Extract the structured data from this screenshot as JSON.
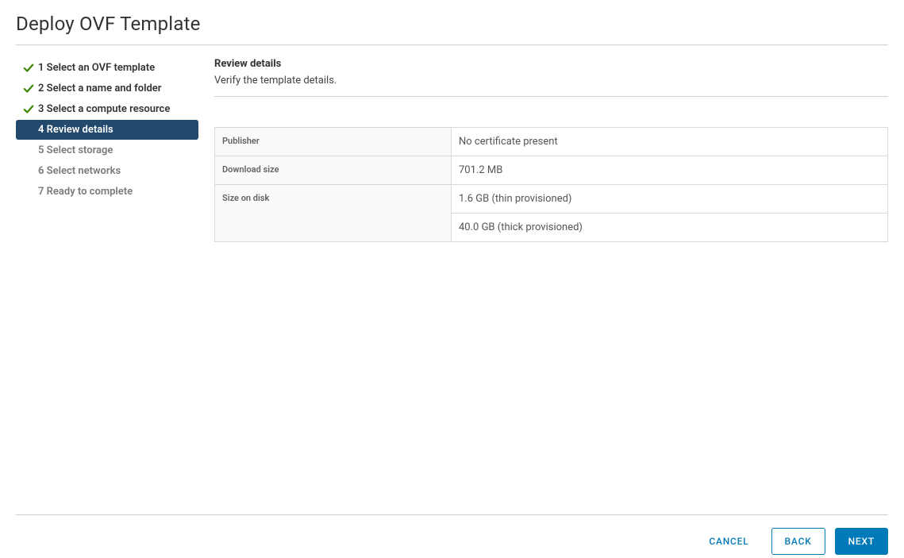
{
  "dialog": {
    "title": "Deploy OVF Template"
  },
  "steps": [
    {
      "label": "1 Select an OVF template",
      "status": "completed"
    },
    {
      "label": "2 Select a name and folder",
      "status": "completed"
    },
    {
      "label": "3 Select a compute resource",
      "status": "completed"
    },
    {
      "label": "4 Review details",
      "status": "active"
    },
    {
      "label": "5 Select storage",
      "status": "pending"
    },
    {
      "label": "6 Select networks",
      "status": "pending"
    },
    {
      "label": "7 Ready to complete",
      "status": "pending"
    }
  ],
  "panel": {
    "title": "Review details",
    "subtitle": "Verify the template details."
  },
  "details": {
    "publisher_label": "Publisher",
    "publisher_value": "No certificate present",
    "download_size_label": "Download size",
    "download_size_value": "701.2 MB",
    "size_on_disk_label": "Size on disk",
    "size_on_disk_thin": "1.6 GB (thin provisioned)",
    "size_on_disk_thick": "40.0 GB (thick provisioned)"
  },
  "footer": {
    "cancel": "CANCEL",
    "back": "BACK",
    "next": "NEXT"
  }
}
